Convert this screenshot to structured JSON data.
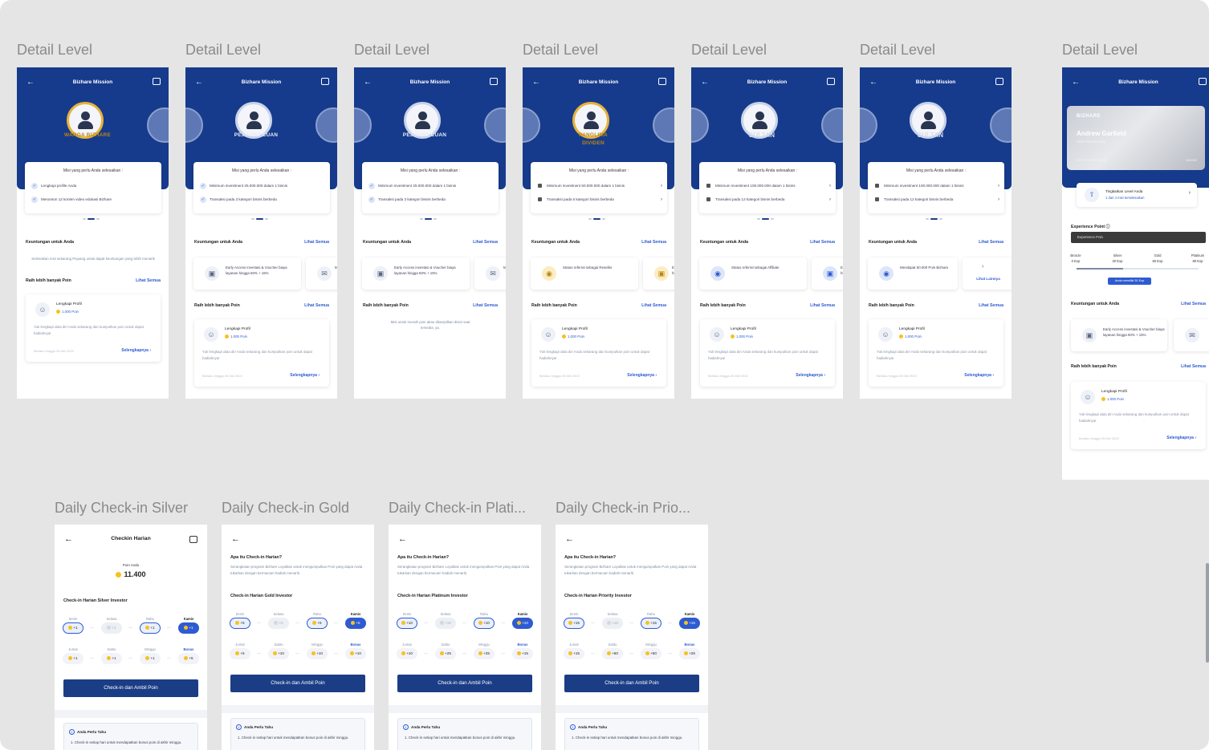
{
  "frames": {
    "detail_title": "Detail Level",
    "checkin_titles": [
      "Daily Check-in Silver",
      "Daily Check-in Gold",
      "Daily Check-in Plati...",
      "Daily Check-in Prio..."
    ]
  },
  "app": {
    "header_title": "Bizhare Mission",
    "missions_heading": "Misi yang perlu Anda selesaikan :",
    "benefits_heading": "Keuntungan untuk Anda",
    "points_heading": "Raih lebih banyak Poin",
    "see_all": "Lihat Semua",
    "see_more": "Lihat Lainnya",
    "empty_benefit": "Selesaikan misi sekarang Pejuang untuk dapat keuntungan yang lebih menarik",
    "empty_points": "Misi untuk meraih poin akan ditampilkan disini saat tersedia, ya.",
    "profile_title": "Lengkapi Profil",
    "profile_points": "1.000 Poin",
    "profile_desc": "Yuk lengkapi data diri Anda sekarang dan kumpulkan poin untuk dapat hadiahnya!",
    "profile_date": "Berlaku hingga 25 Mei 2022",
    "profile_more": "Selengkapnya"
  },
  "levels": [
    {
      "badge": "WARGA BIZHARE",
      "missions": [
        "Lengkapi profile Anda",
        "Menonton 12 konten video edukasi Bizhare"
      ],
      "mission_state": "done"
    },
    {
      "badge": "PEJUANG CUAN",
      "missions": [
        "Minimum investment 25.000.000 dalam 1 bisnis",
        "Transaksi pada 3 kategori bisnis berbeda"
      ],
      "mission_state": "done",
      "benefits": [
        "Early Access investasi & Voucher biaya layanan hingga 50% + 15%",
        "Mer eksl"
      ]
    },
    {
      "badge": "PEJUANG CUAN",
      "missions": [
        "Minimum investment 25.000.000 dalam 1 bisnis",
        "Transaksi pada 3 kategori bisnis berbeda"
      ],
      "mission_state": "done",
      "benefits": [
        "Early Access investasi & Voucher biaya layanan hingga 50% + 15%",
        "Mer eksl"
      ]
    },
    {
      "badge": "PANGLIMA DIVIDEN",
      "missions": [
        "Minimum investment 50.000.000 dalam 1 bisnis",
        "Transaksi pada 6 kategori bisnis berbeda"
      ],
      "mission_state": "locked",
      "benefits": [
        "Status referral sebagai Reseller",
        "Earl Vou hing"
      ]
    },
    {
      "badge": "SULTAN",
      "missions": [
        "Minimum investment 100.000.000 dalam 1 bisnis",
        "Transaksi pada 12 kategori bisnis berbeda"
      ],
      "mission_state": "locked",
      "benefits": [
        "Status referral sebagai Affiliate",
        "Earl Vou hing"
      ]
    },
    {
      "badge": "SULTAN",
      "missions": [
        "Minimum investment 100.000.000 dalam 1 bisnis",
        "Transaksi pada 12 kategori bisnis berbeda"
      ],
      "mission_state": "locked",
      "benefits": [
        "Mendapat 50.000 Poin Bizhare"
      ]
    }
  ],
  "membership": {
    "brand": "BIZHARE",
    "name": "Andrew Garfield",
    "tier": "Silver Membership",
    "card_no": "5078 0164 2909 1230",
    "card_exp": "06/2022",
    "upgrade_title": "Tingkatkan Level Anda",
    "upgrade_sub": "1 dari 4 misi terselesaikan",
    "exp_heading": "Experience Point",
    "exp_placeholder": "Experience Poin",
    "tiers": [
      {
        "name": "Bronze",
        "exp": "0 Exp"
      },
      {
        "name": "Silver",
        "exp": "20 Exp"
      },
      {
        "name": "Gold",
        "exp": "50 Exp"
      },
      {
        "name": "Platinum",
        "exp": "80 Exp"
      }
    ],
    "current_exp": "Anda memiliki 30 Exp",
    "progress_fraction": 0.38,
    "benefit": "Early Access investasi & Voucher biaya layanan hingga 50% + 15%"
  },
  "checkin": {
    "title": "Checkin Harian",
    "points_label": "Poin Anda",
    "points_value": "11.400",
    "what_q": "Apa itu Check-in Harian?",
    "what_desc": "Serangkaian program Bizhare Loyalitas untuk mengumpulkan Poin yang dapat Anda tukarkan dengan bermacam hadiah menarik.",
    "button": "Check-in dan Ambil Poin",
    "info_title": "Anda Perlu Tahu",
    "info_desc": "1.  Check-in setiap hari untuk mendapatkan bonus poin di akhir minggu.",
    "days": [
      "Senin",
      "Selasa",
      "Rabu",
      "Kamis",
      "Jumat",
      "Sabtu",
      "Minggu",
      "Bonus"
    ],
    "variants": [
      {
        "heading": "Check-in Harian Silver Investor",
        "values": [
          "+1",
          "+1",
          "+1",
          "+1",
          "+1",
          "+1",
          "+1",
          "+5"
        ]
      },
      {
        "heading": "Check-in Harian Gold Investor",
        "values": [
          "+5",
          "+5",
          "+5",
          "+5",
          "+5",
          "+10",
          "+10",
          "+10"
        ]
      },
      {
        "heading": "Check-in Harian Platinum Investor",
        "values": [
          "+10",
          "+10",
          "+10",
          "+10",
          "+10",
          "+25",
          "+25",
          "+15"
        ]
      },
      {
        "heading": "Check-in Harian Priority Investor",
        "values": [
          "+15",
          "+15",
          "+15",
          "+15",
          "+15",
          "+50",
          "+50",
          "+25"
        ]
      }
    ]
  }
}
